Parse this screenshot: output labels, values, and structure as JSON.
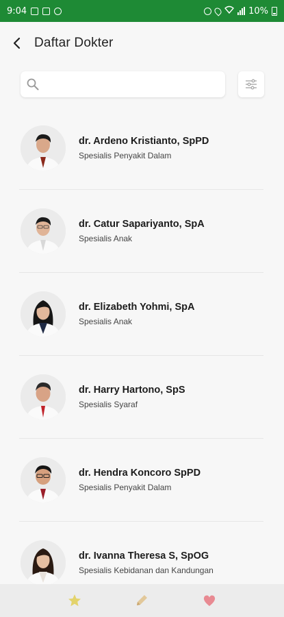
{
  "status_bar": {
    "time": "9:04",
    "battery": "10%"
  },
  "header": {
    "title": "Daftar Dokter"
  },
  "search": {
    "placeholder": "",
    "value": ""
  },
  "doctors": [
    {
      "name": "dr. Ardeno Kristianto, SpPD",
      "specialty": "Spesialis Penyakit Dalam",
      "tie_color": "#8b2a1c"
    },
    {
      "name": "dr. Catur Sapariyanto, SpA",
      "specialty": "Spesialis Anak",
      "tie_color": "#d8d8d8"
    },
    {
      "name": "dr. Elizabeth Yohmi, SpA",
      "specialty": "Spesialis Anak",
      "tie_color": "#1f2a44"
    },
    {
      "name": "dr. Harry Hartono, SpS",
      "specialty": "Spesialis Syaraf",
      "tie_color": "#c0232a"
    },
    {
      "name": "dr. Hendra Koncoro SpPD",
      "specialty": "Spesialis Penyakit Dalam",
      "tie_color": "#9b1f2a"
    },
    {
      "name": "dr. Ivanna Theresa S, SpOG",
      "specialty": "Spesialis Kebidanan dan Kandungan",
      "tie_color": "#e8e2dc"
    }
  ],
  "bottom_nav": [
    {
      "icon": "star-icon",
      "color": "#e3d36b"
    },
    {
      "icon": "pencil-icon",
      "color": "#e2c89a"
    },
    {
      "icon": "heart-icon",
      "color": "#e88a92"
    }
  ],
  "colors": {
    "status_bar": "#1e8a35",
    "background": "#f7f7f7"
  }
}
